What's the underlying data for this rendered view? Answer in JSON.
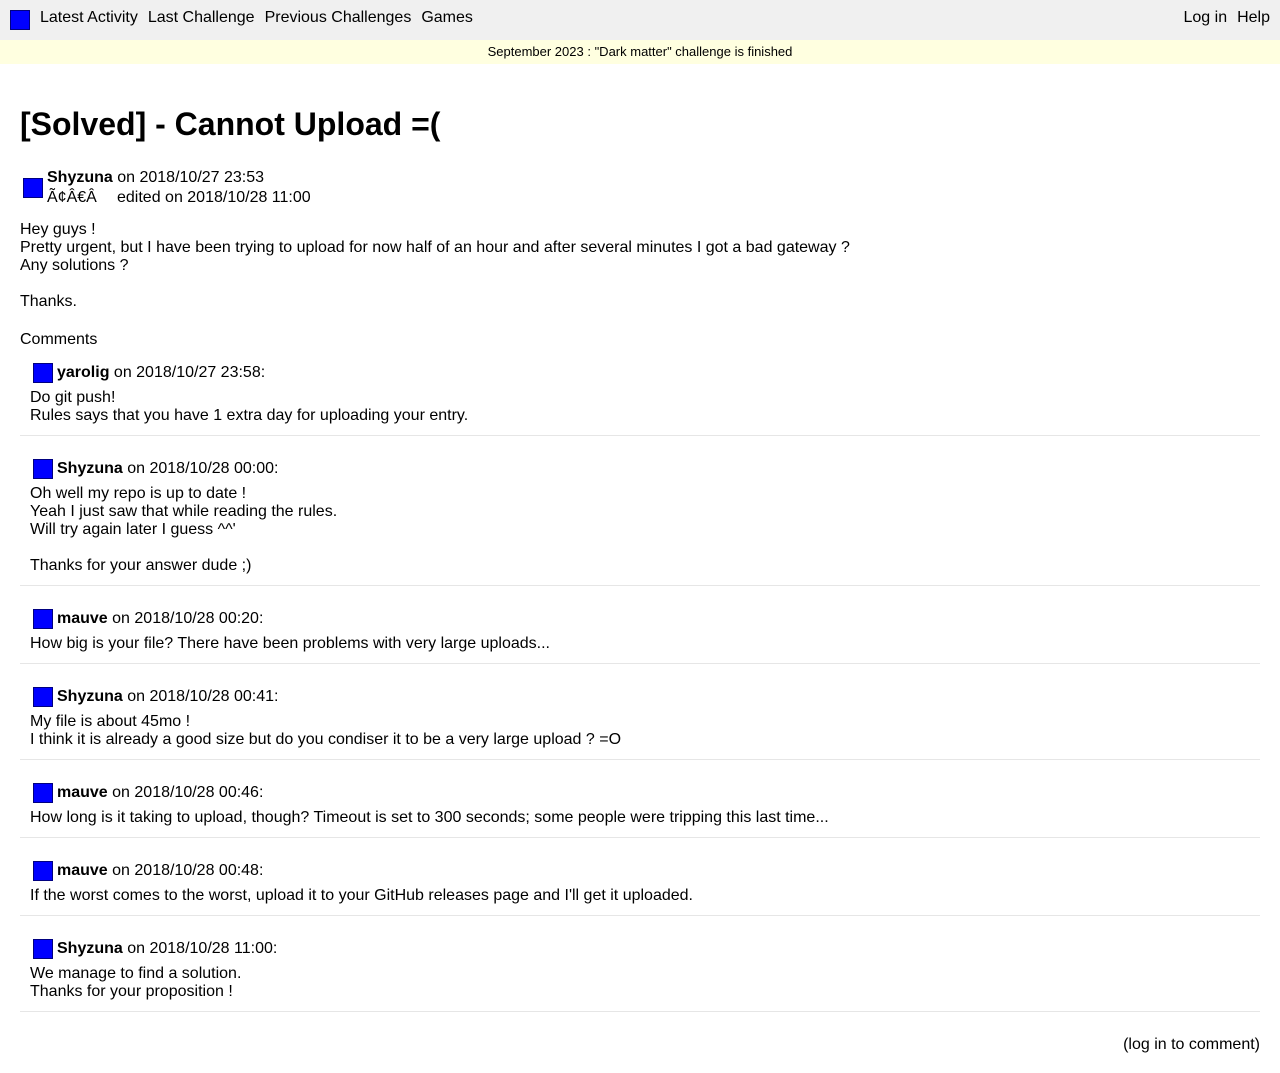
{
  "nav": {
    "left": [
      "Latest Activity",
      "Last Challenge",
      "Previous Challenges",
      "Games"
    ],
    "right": [
      "Log in",
      "Help"
    ]
  },
  "banner": "September 2023 : \"Dark matter\" challenge is finished",
  "post": {
    "title": "[Solved] - Cannot Upload =(",
    "author": "Shyzuna",
    "date": " on 2018/10/27 23:53",
    "garbled": "Ã¢Â€Â",
    "edited": "edited on 2018/10/28 11:00",
    "body": [
      "Hey guys !",
      "Pretty urgent, but I have been trying to upload for now half of an hour and after several minutes I got a bad gateway ?",
      "Any solutions ?"
    ],
    "thanks": "Thanks."
  },
  "comments_label": "Comments",
  "comments": [
    {
      "author": "yarolig",
      "date": " on 2018/10/27 23:58:",
      "paragraphs": [
        [
          "Do git push!",
          "Rules says that you have 1 extra day for uploading your entry."
        ]
      ]
    },
    {
      "author": "Shyzuna",
      "date": " on 2018/10/28 00:00:",
      "paragraphs": [
        [
          "Oh well my repo is up to date !",
          "Yeah I just saw that while reading the rules.",
          "Will try again later I guess ^^'"
        ],
        [
          "Thanks for your answer dude ;)"
        ]
      ]
    },
    {
      "author": "mauve",
      "date": " on 2018/10/28 00:20:",
      "paragraphs": [
        [
          "How big is your file? There have been problems with very large uploads..."
        ]
      ]
    },
    {
      "author": "Shyzuna",
      "date": " on 2018/10/28 00:41:",
      "paragraphs": [
        [
          "My file is about 45mo !",
          "I think it is already a good size but do you condiser it to be a very large upload ? =O"
        ]
      ]
    },
    {
      "author": "mauve",
      "date": " on 2018/10/28 00:46:",
      "paragraphs": [
        [
          "How long is it taking to upload, though? Timeout is set to 300 seconds; some people were tripping this last time..."
        ]
      ]
    },
    {
      "author": "mauve",
      "date": " on 2018/10/28 00:48:",
      "paragraphs": [
        [
          "If the worst comes to the worst, upload it to your GitHub releases page and I'll get it uploaded."
        ]
      ]
    },
    {
      "author": "Shyzuna",
      "date": " on 2018/10/28 11:00:",
      "paragraphs": [
        [
          "We manage to find a solution.",
          "Thanks for your proposition !"
        ]
      ]
    }
  ],
  "login_to_comment": "(log in to comment)",
  "colors": {
    "avatar": "#0000ff",
    "topbar": "#f0f0f0",
    "banner": "#ffffe0"
  }
}
